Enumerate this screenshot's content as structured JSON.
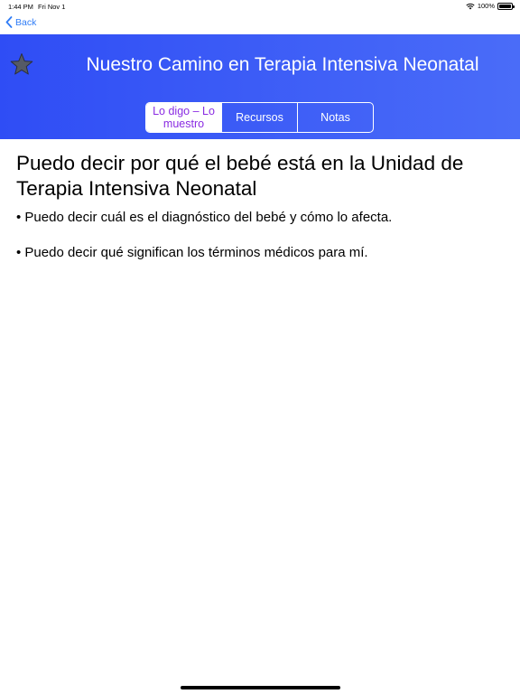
{
  "status_bar": {
    "time": "1:44 PM",
    "date": "Fri Nov 1",
    "battery": "100%"
  },
  "nav": {
    "back_label": "Back"
  },
  "header": {
    "title": "Nuestro Camino en Terapia Intensiva Neonatal"
  },
  "tabs": [
    {
      "label": "Lo digo – Lo muestro",
      "selected": true
    },
    {
      "label": "Recursos",
      "selected": false
    },
    {
      "label": "Notas",
      "selected": false
    }
  ],
  "content": {
    "heading": "Puedo decir por qué el bebé está en la Unidad de Terapia Intensiva Neonatal",
    "bullets": [
      "• Puedo decir cuál es el diagnóstico del bebé y cómo lo afecta.",
      "• Puedo decir qué significan los términos médicos para mí."
    ]
  },
  "colors": {
    "header_start": "#2f4df5",
    "header_end": "#4a6cf8",
    "accent": "#2f7cf6",
    "selected_tab_text": "#8a2be2"
  }
}
